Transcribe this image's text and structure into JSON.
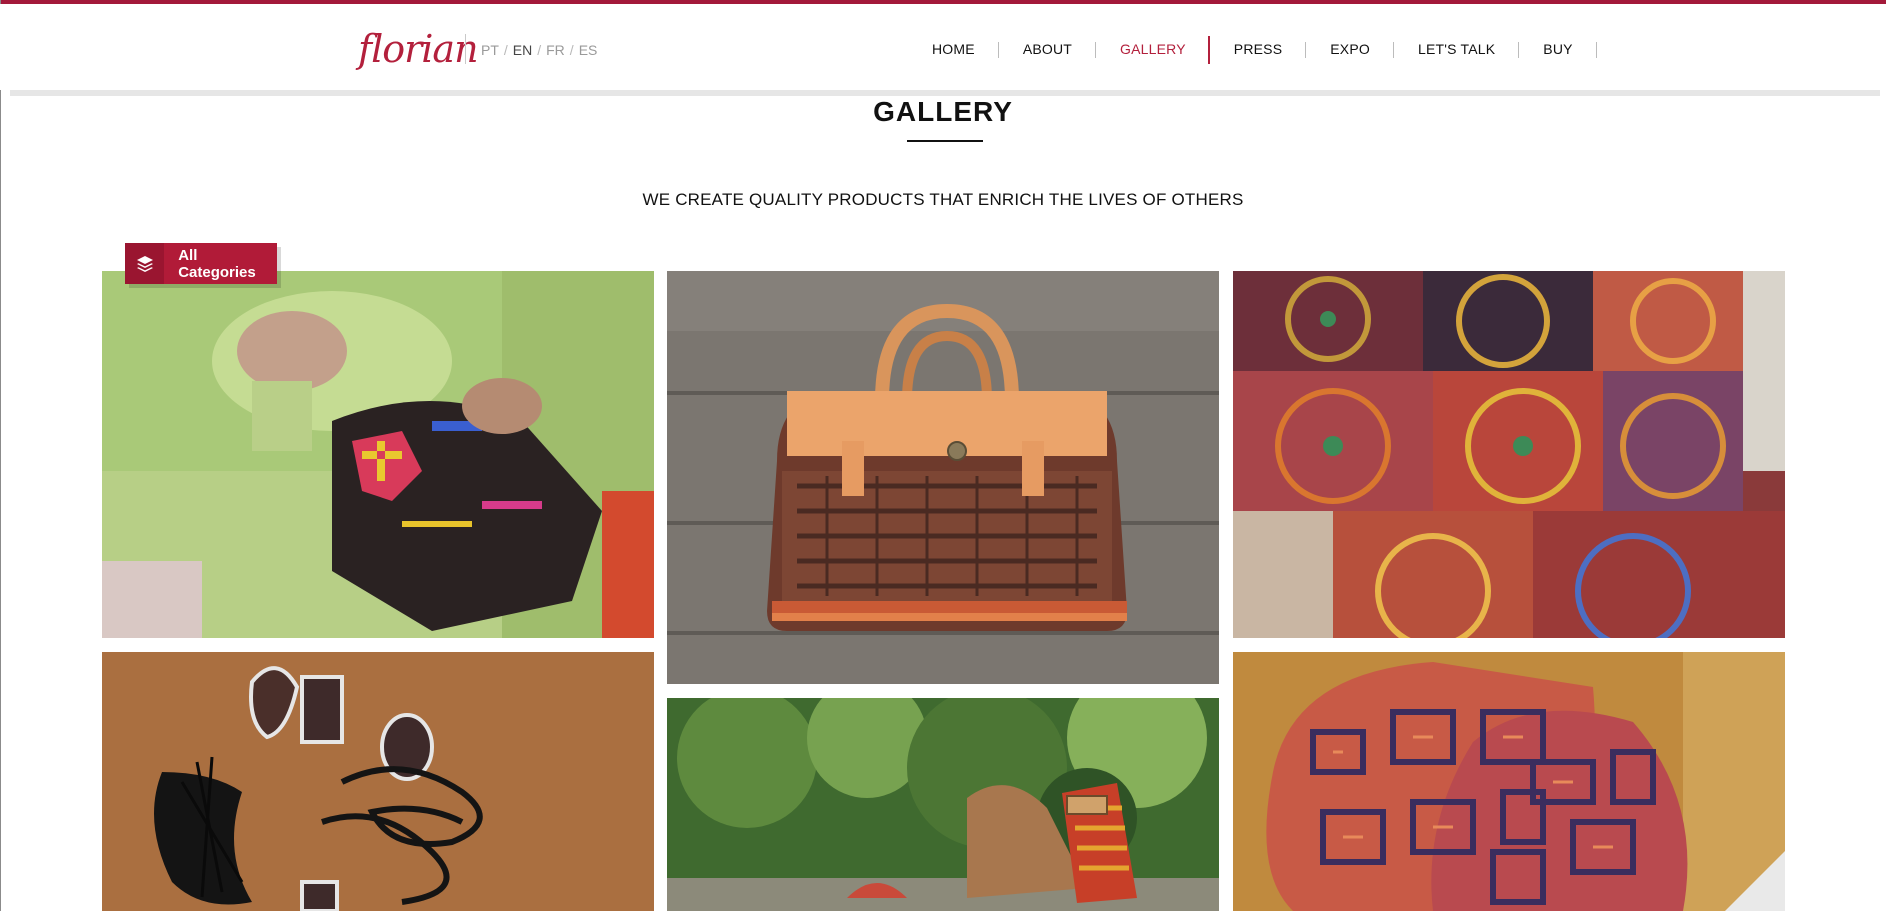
{
  "brand": {
    "logo_text": "florian",
    "accent_color": "#b3203c"
  },
  "languages": [
    {
      "code": "PT",
      "active": false
    },
    {
      "code": "EN",
      "active": true
    },
    {
      "code": "FR",
      "active": false
    },
    {
      "code": "ES",
      "active": false
    }
  ],
  "nav": {
    "items": [
      {
        "label": "HOME",
        "active": false
      },
      {
        "label": "ABOUT",
        "active": false
      },
      {
        "label": "GALLERY",
        "active": true
      },
      {
        "label": "PRESS",
        "active": false
      },
      {
        "label": "EXPO",
        "active": false
      },
      {
        "label": "LET'S TALK",
        "active": false
      },
      {
        "label": "BUY",
        "active": false
      }
    ]
  },
  "page": {
    "title": "GALLERY",
    "tagline": "WE CREATE QUALITY PRODUCTS THAT ENRICH THE LIVES OF OTHERS"
  },
  "filter": {
    "label": "All Categories",
    "icon": "layers-icon"
  },
  "gallery": {
    "items": [
      {
        "subject": "artisan embroidering textile"
      },
      {
        "subject": "leather handbag with embroidered fabric"
      },
      {
        "subject": "circular embroidered textiles"
      },
      {
        "subject": "necklace with feathers"
      },
      {
        "subject": "embroidered sandal"
      },
      {
        "subject": "embroidered cushions"
      }
    ]
  }
}
